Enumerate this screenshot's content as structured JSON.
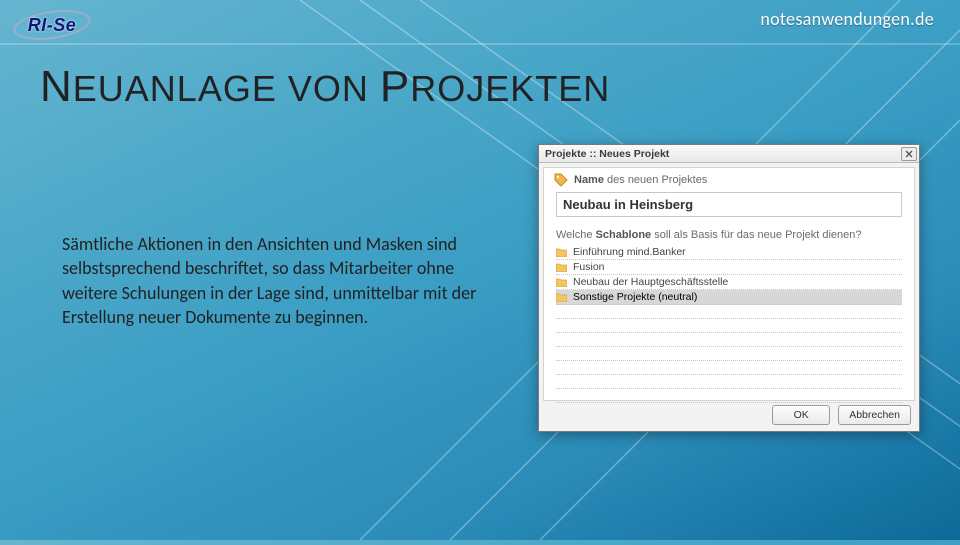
{
  "header": {
    "logo_text": "RI-Se",
    "url": "notesanwendungen.de"
  },
  "title": {
    "l1": "N",
    "t1": "EUANLAGE",
    "sep": " VON ",
    "l2": "P",
    "t2": "ROJEKTEN"
  },
  "body": "Sämtliche Aktionen in den Ansichten und Masken sind selbstsprechend beschriftet, so dass Mitarbeiter ohne weitere Schulungen in der Lage sind, unmittelbar mit der Erstellung neuer Dokumente zu beginnen.",
  "dialog": {
    "title": "Projekte :: Neues Projekt",
    "name_label_bold": "Name",
    "name_label_rest": " des neuen Projektes",
    "name_value": "Neubau in Heinsberg",
    "question_pre": "Welche ",
    "question_bold": "Schablone",
    "question_post": " soll als Basis für das neue Projekt dienen?",
    "templates": [
      "Einführung mind.Banker",
      "Fusion",
      "Neubau der Hauptgeschäftsstelle",
      "Sonstige Projekte (neutral)"
    ],
    "selected_index": 3,
    "ok": "OK",
    "cancel": "Abbrechen"
  }
}
